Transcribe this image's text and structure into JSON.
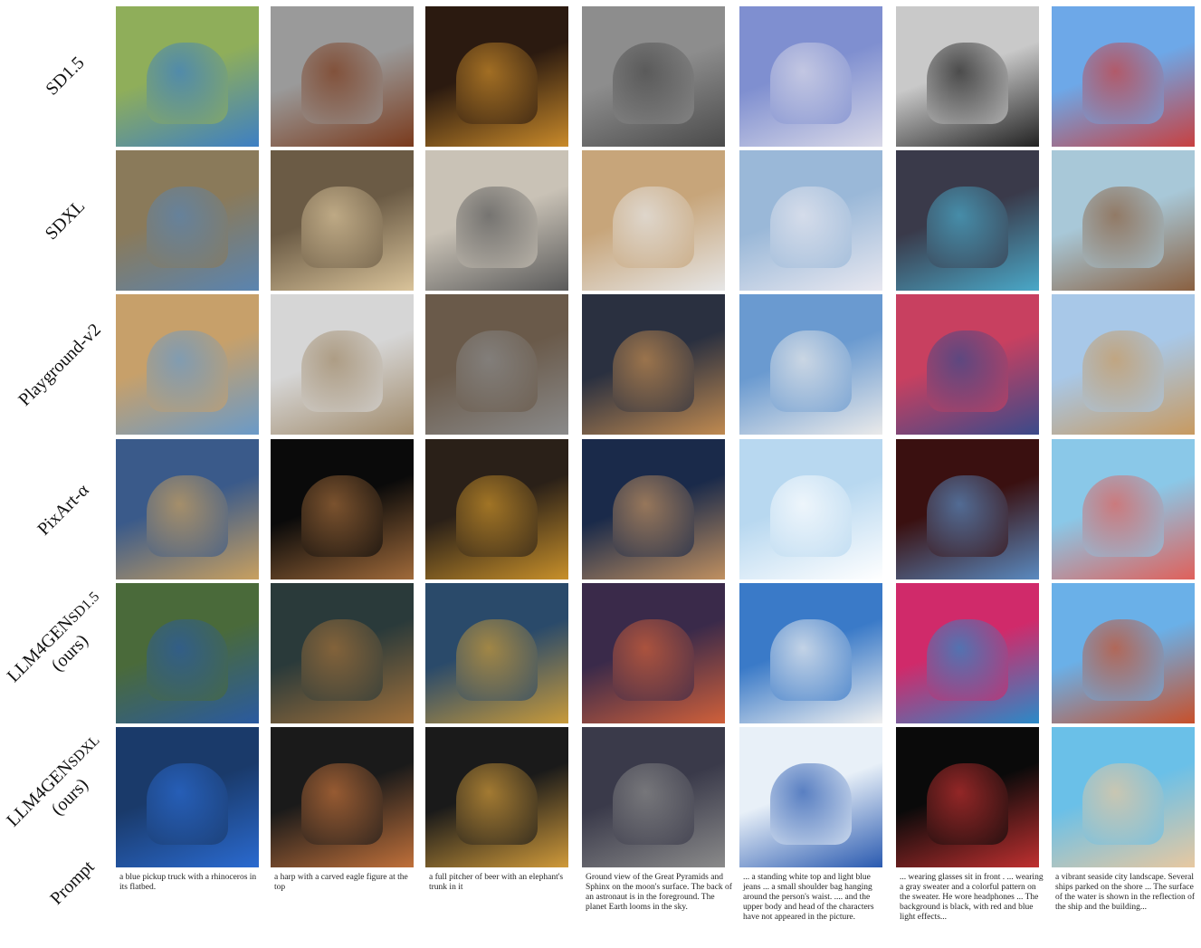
{
  "row_labels": [
    {
      "main": "SD1.5",
      "sub": "",
      "line2": ""
    },
    {
      "main": "SDXL",
      "sub": "",
      "line2": ""
    },
    {
      "main": "Playground-v2",
      "sub": "",
      "line2": ""
    },
    {
      "main": "PixArt-α",
      "sub": "",
      "line2": ""
    },
    {
      "main": "LLM4GEN",
      "sub": "SD1.5",
      "line2": "(ours)"
    },
    {
      "main": "LLM4GEN",
      "sub": "SDXL",
      "line2": "(ours)"
    }
  ],
  "prompt_label": "Prompt",
  "prompts": [
    "a blue pickup truck with a rhinoceros in its flatbed.",
    "a harp with a carved eagle figure at the top",
    "a full pitcher of beer with an elephant's trunk in it",
    "Ground view of the Great Pyramids and Sphinx on the moon's surface. The back of an astronaut is in the foreground. The planet Earth looms in the sky.",
    "... a standing white top and light blue jeans ... a small shoulder bag hanging around the person's waist. .... and the upper body and head of the characters have not appeared in the picture.",
    "... wearing glasses sit in front . ... wearing a gray sweater and a colorful pattern on the sweater. He wore headphones ... The background is black, with red and blue light effects...",
    "a vibrant seaside city landscape. Several ships parked on the shore ... The surface of the water is shown in the reflection of the ship and the building..."
  ],
  "columns": [
    "truck-rhino",
    "harp-eagle",
    "beer-elephant",
    "pyramids-moon",
    "woman-bag",
    "man-headphones",
    "seaside-city"
  ],
  "tile_colors": [
    [
      [
        "#8fae5a",
        "#3d7fc4"
      ],
      [
        "#9a9a9a",
        "#7a3a1c"
      ],
      [
        "#2b1a10",
        "#c98a2a"
      ],
      [
        "#8d8d8d",
        "#4a4a4a"
      ],
      [
        "#7f8fd0",
        "#d9d9e8"
      ],
      [
        "#c9c9c9",
        "#222222"
      ],
      [
        "#6da8e8",
        "#c84040"
      ]
    ],
    [
      [
        "#8a7a5a",
        "#5a84b0"
      ],
      [
        "#6b5b45",
        "#d9c39a"
      ],
      [
        "#c9c2b6",
        "#5a5a5a"
      ],
      [
        "#c7a57a",
        "#e6e6e6"
      ],
      [
        "#9ab8d8",
        "#e8e8f0"
      ],
      [
        "#3a3a4a",
        "#4aa8c8"
      ],
      [
        "#a8c8d8",
        "#8a6040"
      ]
    ],
    [
      [
        "#c7a06a",
        "#6a9ac8"
      ],
      [
        "#d6d6d6",
        "#a08a6a"
      ],
      [
        "#6a5a4a",
        "#8a8a8a"
      ],
      [
        "#2a3040",
        "#c08a50"
      ],
      [
        "#6a9ad0",
        "#eaeaea"
      ],
      [
        "#c84060",
        "#3a4a8a"
      ],
      [
        "#a8c8e8",
        "#c89a60"
      ]
    ],
    [
      [
        "#3a5a8a",
        "#c8a060"
      ],
      [
        "#0a0a0a",
        "#a06a3a"
      ],
      [
        "#2a2018",
        "#c8902a"
      ],
      [
        "#1a2a4a",
        "#c09060"
      ],
      [
        "#b8d8f0",
        "#ffffff"
      ],
      [
        "#3a1010",
        "#5a8ac0"
      ],
      [
        "#8ac8e8",
        "#e0605a"
      ]
    ],
    [
      [
        "#4a6a3a",
        "#2a5aa0"
      ],
      [
        "#2a3a3a",
        "#a0703a"
      ],
      [
        "#2a4a6a",
        "#c89a3a"
      ],
      [
        "#3a2a4a",
        "#d0603a"
      ],
      [
        "#3a7ac8",
        "#f0f0f0"
      ],
      [
        "#d02a6a",
        "#2a8ac8"
      ],
      [
        "#6ab0e8",
        "#c8502a"
      ]
    ],
    [
      [
        "#1a3a6a",
        "#2a6ad0"
      ],
      [
        "#1a1a1a",
        "#c0703a"
      ],
      [
        "#1a1a1a",
        "#d09a3a"
      ],
      [
        "#3a3a4a",
        "#8a8a8a"
      ],
      [
        "#e8f0f8",
        "#2a5ab0"
      ],
      [
        "#0a0a0a",
        "#c03030"
      ],
      [
        "#6ac0e8",
        "#e8c8a0"
      ]
    ]
  ]
}
